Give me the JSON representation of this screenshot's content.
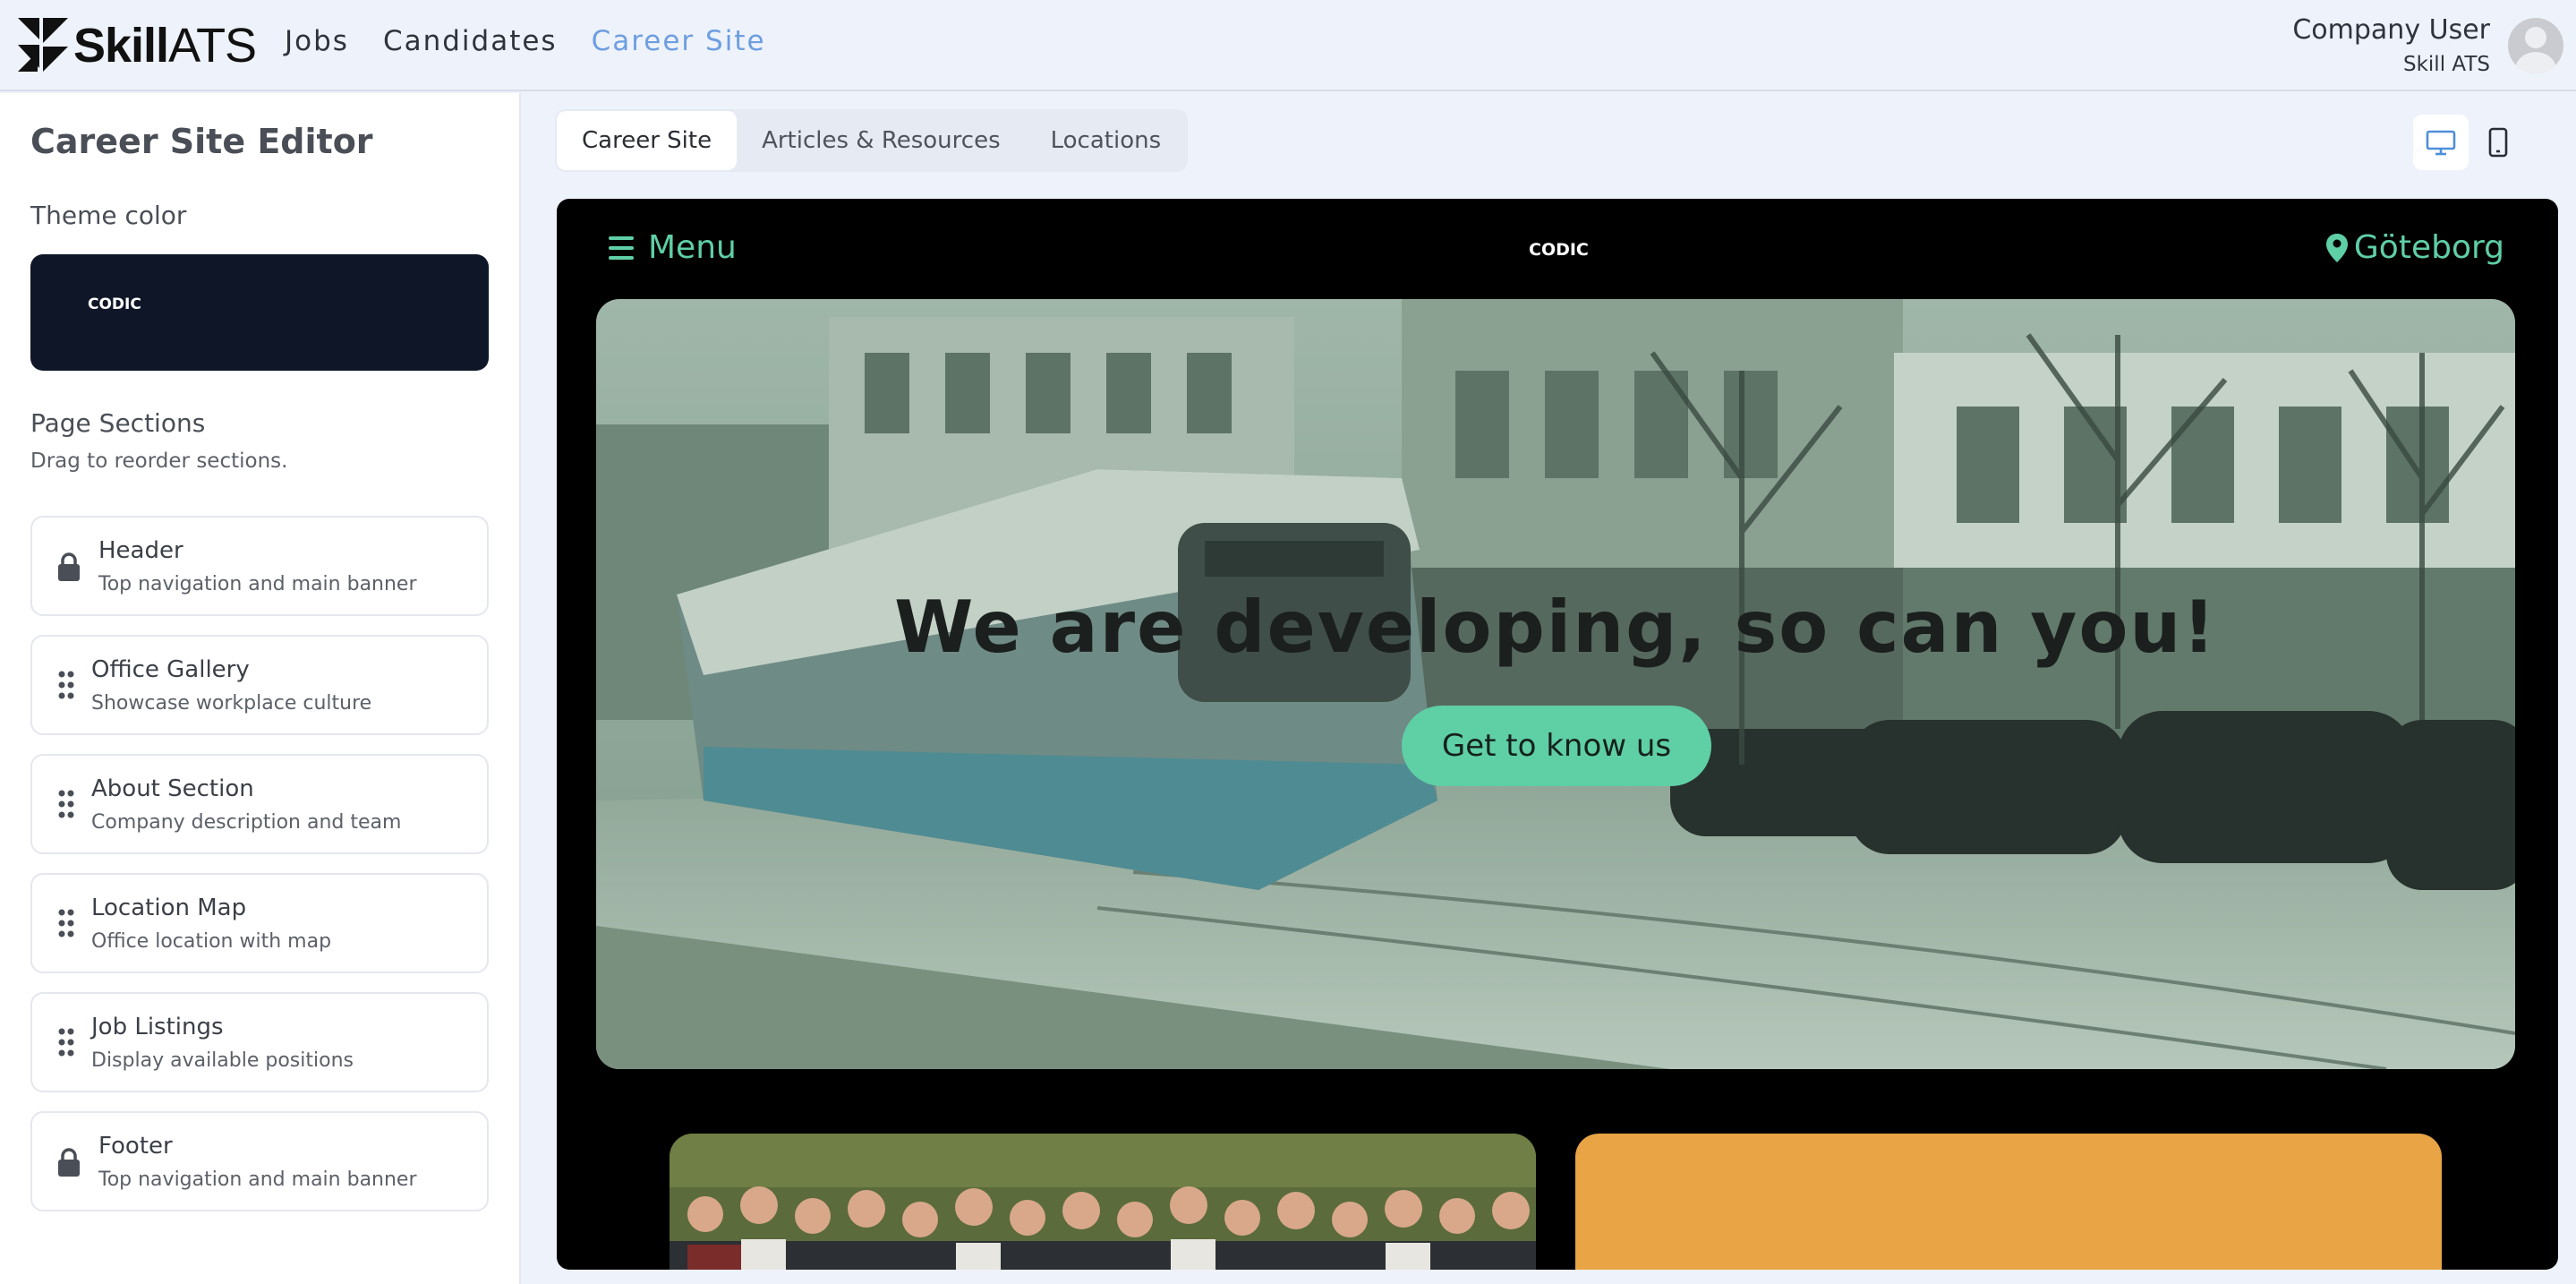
{
  "app": {
    "logo_bold": "Skill",
    "logo_light": "ATS"
  },
  "nav": {
    "items": [
      {
        "label": "Jobs",
        "active": false
      },
      {
        "label": "Candidates",
        "active": false
      },
      {
        "label": "Career Site",
        "active": true
      }
    ]
  },
  "user": {
    "name": "Company User",
    "company": "Skill ATS"
  },
  "sidebar": {
    "title": "Career Site Editor",
    "theme_label": "Theme color",
    "theme_logo": "CODIC",
    "theme_color": "#0f1628",
    "sections_label": "Page Sections",
    "sections_hint": "Drag to reorder sections.",
    "sections": [
      {
        "title": "Header",
        "desc": "Top navigation and main banner",
        "locked": true
      },
      {
        "title": "Office Gallery",
        "desc": "Showcase workplace culture",
        "locked": false
      },
      {
        "title": "About Section",
        "desc": "Company description and team",
        "locked": false
      },
      {
        "title": "Location Map",
        "desc": "Office location with map",
        "locked": false
      },
      {
        "title": "Job Listings",
        "desc": "Display available positions",
        "locked": false
      },
      {
        "title": "Footer",
        "desc": "Top navigation and main banner",
        "locked": true
      }
    ]
  },
  "tabs": [
    {
      "label": "Career Site",
      "active": true
    },
    {
      "label": "Articles & Resources",
      "active": false
    },
    {
      "label": "Locations",
      "active": false
    }
  ],
  "devices": {
    "desktop": {
      "icon": "desktop-icon",
      "active": true
    },
    "mobile": {
      "icon": "mobile-icon",
      "active": false
    }
  },
  "preview": {
    "menu_label": "Menu",
    "logo": "CODIC",
    "location": "Göteborg",
    "accent_color": "#5fcfa6",
    "hero_title": "We are developing, so can you!",
    "hero_button": "Get to know us",
    "card_color": "#e8a445"
  }
}
